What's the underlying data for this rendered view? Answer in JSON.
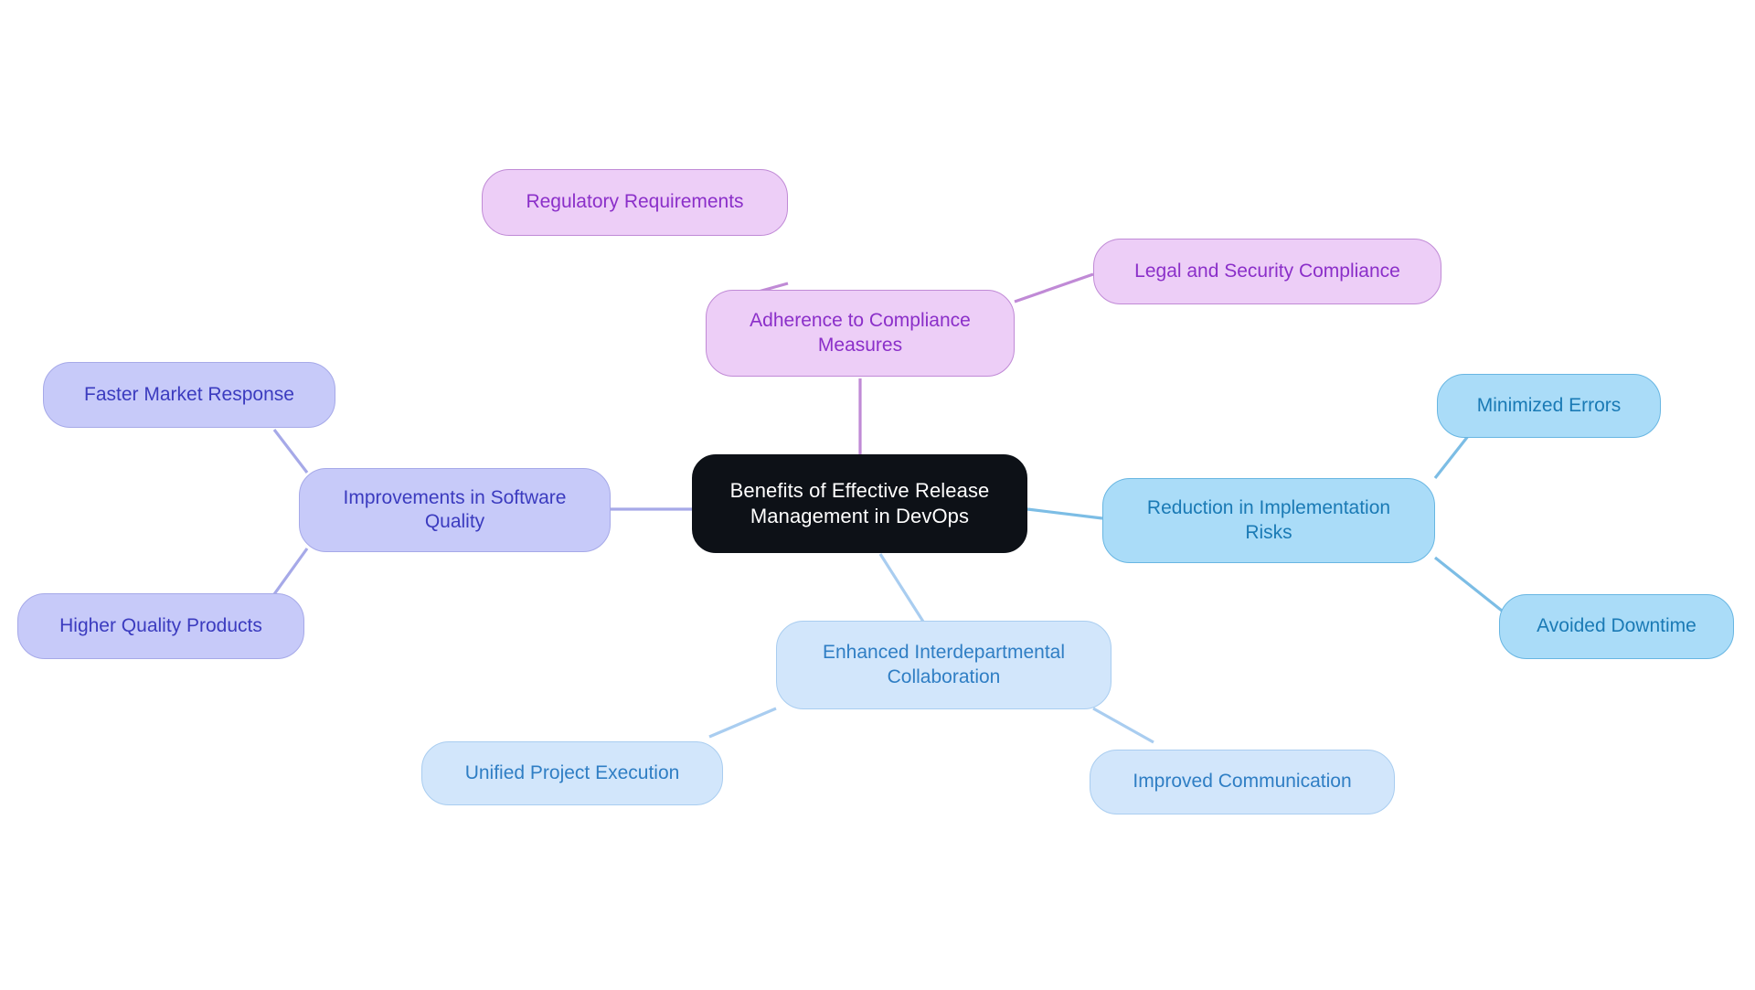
{
  "diagram": {
    "type": "mindmap",
    "title": "Benefits of Effective Release Management in DevOps",
    "background_color": "#ffffff",
    "root": {
      "id": "root",
      "label": "Benefits of Effective Release\nManagement in DevOps",
      "fill": "#0d1117",
      "text_color": "#ffffff"
    },
    "branches": [
      {
        "id": "compliance",
        "label": "Adherence to Compliance\nMeasures",
        "fill": "#edcef7",
        "border": "#c08ad6",
        "text_color": "#8b2fc9",
        "children": [
          {
            "id": "regulatory-requirements",
            "label": "Regulatory Requirements",
            "fill": "#edcef7",
            "border": "#c08ad6",
            "text_color": "#8b2fc9"
          },
          {
            "id": "legal-security-compliance",
            "label": "Legal and Security Compliance",
            "fill": "#edcef7",
            "border": "#c08ad6",
            "text_color": "#8b2fc9"
          }
        ]
      },
      {
        "id": "software-quality",
        "label": "Improvements in Software\nQuality",
        "fill": "#c7caf9",
        "border": "#a6a9e8",
        "text_color": "#3b3bbf",
        "children": [
          {
            "id": "faster-market-response",
            "label": "Faster Market Response",
            "fill": "#c7caf9",
            "border": "#a6a9e8",
            "text_color": "#3b3bbf"
          },
          {
            "id": "higher-quality-products",
            "label": "Higher Quality Products",
            "fill": "#c7caf9",
            "border": "#a6a9e8",
            "text_color": "#3b3bbf"
          }
        ]
      },
      {
        "id": "implementation-risks",
        "label": "Reduction in Implementation\nRisks",
        "fill": "#aadcf8",
        "border": "#68b6e2",
        "text_color": "#1a7ab5",
        "children": [
          {
            "id": "minimized-errors",
            "label": "Minimized Errors",
            "fill": "#aadcf8",
            "border": "#68b6e2",
            "text_color": "#1a7ab5"
          },
          {
            "id": "avoided-downtime",
            "label": "Avoided Downtime",
            "fill": "#aadcf8",
            "border": "#68b6e2",
            "text_color": "#1a7ab5"
          }
        ]
      },
      {
        "id": "collaboration",
        "label": "Enhanced Interdepartmental\nCollaboration",
        "fill": "#d2e6fb",
        "border": "#a9cdf0",
        "text_color": "#2f7ec4",
        "children": [
          {
            "id": "unified-project-execution",
            "label": "Unified Project Execution",
            "fill": "#d2e6fb",
            "border": "#a9cdf0",
            "text_color": "#2f7ec4"
          },
          {
            "id": "improved-communication",
            "label": "Improved Communication",
            "fill": "#d2e6fb",
            "border": "#a9cdf0",
            "text_color": "#2f7ec4"
          }
        ]
      }
    ],
    "edges": [
      {
        "from": "root",
        "to": "compliance",
        "color": "#c08ad6"
      },
      {
        "from": "compliance",
        "to": "regulatory-requirements",
        "color": "#c08ad6"
      },
      {
        "from": "compliance",
        "to": "legal-security-compliance",
        "color": "#c08ad6"
      },
      {
        "from": "root",
        "to": "software-quality",
        "color": "#a6a9e8"
      },
      {
        "from": "software-quality",
        "to": "faster-market-response",
        "color": "#a6a9e8"
      },
      {
        "from": "software-quality",
        "to": "higher-quality-products",
        "color": "#a6a9e8"
      },
      {
        "from": "root",
        "to": "implementation-risks",
        "color": "#7cbde5"
      },
      {
        "from": "implementation-risks",
        "to": "minimized-errors",
        "color": "#7cbde5"
      },
      {
        "from": "implementation-risks",
        "to": "avoided-downtime",
        "color": "#7cbde5"
      },
      {
        "from": "root",
        "to": "collaboration",
        "color": "#a9cdf0"
      },
      {
        "from": "collaboration",
        "to": "unified-project-execution",
        "color": "#a9cdf0"
      },
      {
        "from": "collaboration",
        "to": "improved-communication",
        "color": "#a9cdf0"
      }
    ]
  }
}
